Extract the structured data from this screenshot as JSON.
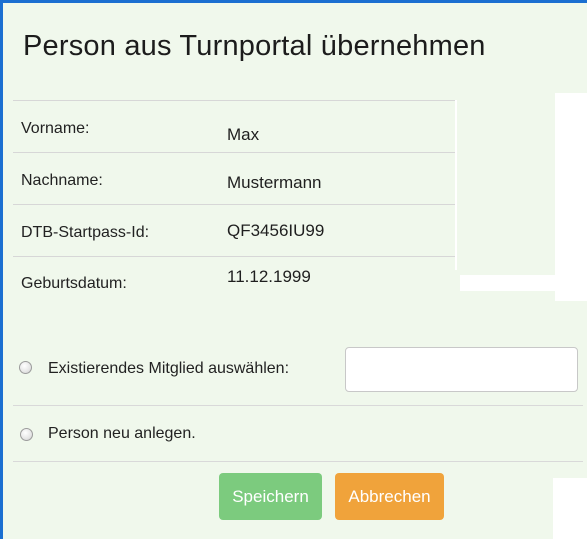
{
  "dialog": {
    "title": "Person aus Turnportal übernehmen"
  },
  "person": {
    "fields": [
      {
        "label": "Vorname:",
        "value": "Max"
      },
      {
        "label": "Nachname:",
        "value": "Mustermann"
      },
      {
        "label": "DTB-Startpass-Id:",
        "value": "QF3456IU99"
      },
      {
        "label": "Geburtsdatum:",
        "value": "11.12.1999"
      }
    ]
  },
  "options": {
    "existing_member_label": "Existierendes Mitglied auswählen:",
    "existing_member_value": "",
    "new_person_label": "Person neu anlegen."
  },
  "buttons": {
    "save_label": "Speichern",
    "cancel_label": "Abbrechen"
  },
  "colors": {
    "frame": "#1b6fd1",
    "dialog_background": "#f0f8ec",
    "save_button": "#7ccb7e",
    "cancel_button": "#f0a33b"
  }
}
